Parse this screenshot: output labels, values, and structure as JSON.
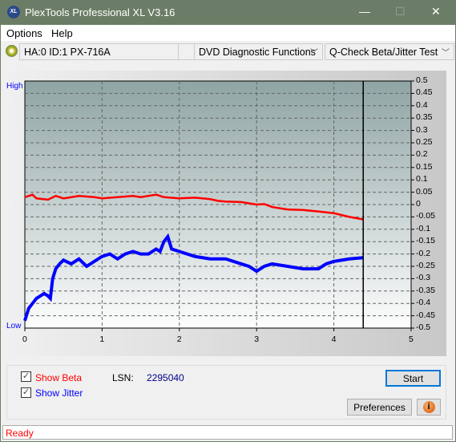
{
  "window": {
    "title": "PlexTools Professional XL V3.16",
    "logo": "XL",
    "minimize": "—",
    "maximize": "☐",
    "close": "✕"
  },
  "menu": [
    "Options",
    "Help"
  ],
  "toolbar": {
    "drive": "HA:0 ID:1  PX-716A",
    "function": "DVD Diagnostic Functions",
    "test": "Q-Check Beta/Jitter Test",
    "chevron": "﹀"
  },
  "chart_data": {
    "type": "line",
    "left_labels": {
      "high": "High",
      "low": "Low"
    },
    "xlim": [
      0,
      5
    ],
    "ylim": [
      -0.5,
      0.5
    ],
    "x_ticks": [
      "0",
      "1",
      "2",
      "3",
      "4",
      "5"
    ],
    "y_ticks": [
      "0.5",
      "0.45",
      "0.4",
      "0.35",
      "0.3",
      "0.25",
      "0.2",
      "0.15",
      "0.1",
      "0.05",
      "0",
      "-0.05",
      "-0.1",
      "-0.15",
      "-0.2",
      "-0.25",
      "-0.3",
      "-0.35",
      "-0.4",
      "-0.45",
      "-0.5"
    ],
    "grid": true,
    "marker_x": 4.38,
    "series": [
      {
        "key": "beta",
        "color": "#ff0000",
        "x": [
          0,
          0.1,
          0.15,
          0.3,
          0.4,
          0.5,
          0.7,
          0.9,
          1.0,
          1.2,
          1.4,
          1.5,
          1.7,
          1.8,
          2.0,
          2.2,
          2.4,
          2.5,
          2.6,
          2.8,
          3.0,
          3.1,
          3.2,
          3.4,
          3.6,
          3.8,
          4.0,
          4.2,
          4.38
        ],
        "y": [
          0.03,
          0.04,
          0.025,
          0.02,
          0.035,
          0.025,
          0.035,
          0.03,
          0.025,
          0.03,
          0.035,
          0.03,
          0.04,
          0.03,
          0.025,
          0.028,
          0.022,
          0.015,
          0.012,
          0.01,
          0.0,
          0.002,
          -0.01,
          -0.02,
          -0.022,
          -0.028,
          -0.035,
          -0.05,
          -0.06
        ]
      },
      {
        "key": "jitter",
        "color": "#0000ff",
        "x": [
          0,
          0.05,
          0.1,
          0.15,
          0.2,
          0.25,
          0.3,
          0.33,
          0.36,
          0.4,
          0.45,
          0.5,
          0.6,
          0.7,
          0.8,
          0.9,
          1.0,
          1.1,
          1.2,
          1.3,
          1.4,
          1.5,
          1.6,
          1.7,
          1.75,
          1.8,
          1.85,
          1.9,
          2.0,
          2.2,
          2.4,
          2.6,
          2.8,
          2.9,
          3.0,
          3.1,
          3.2,
          3.4,
          3.6,
          3.8,
          3.9,
          4.0,
          4.2,
          4.38
        ],
        "y": [
          -0.47,
          -0.42,
          -0.4,
          -0.38,
          -0.37,
          -0.36,
          -0.37,
          -0.38,
          -0.3,
          -0.26,
          -0.24,
          -0.225,
          -0.24,
          -0.22,
          -0.25,
          -0.23,
          -0.21,
          -0.2,
          -0.22,
          -0.2,
          -0.19,
          -0.2,
          -0.2,
          -0.18,
          -0.19,
          -0.15,
          -0.13,
          -0.18,
          -0.19,
          -0.21,
          -0.22,
          -0.22,
          -0.24,
          -0.25,
          -0.27,
          -0.25,
          -0.24,
          -0.25,
          -0.26,
          -0.26,
          -0.24,
          -0.23,
          -0.22,
          -0.215
        ]
      }
    ]
  },
  "controls": {
    "show_beta": "Show Beta",
    "show_jitter": "Show Jitter",
    "show_beta_checked": true,
    "show_jitter_checked": true,
    "lsn_label": "LSN:",
    "lsn_value": "2295040",
    "start": "Start",
    "preferences": "Preferences",
    "info": "i",
    "check": "✓"
  },
  "status": "Ready"
}
